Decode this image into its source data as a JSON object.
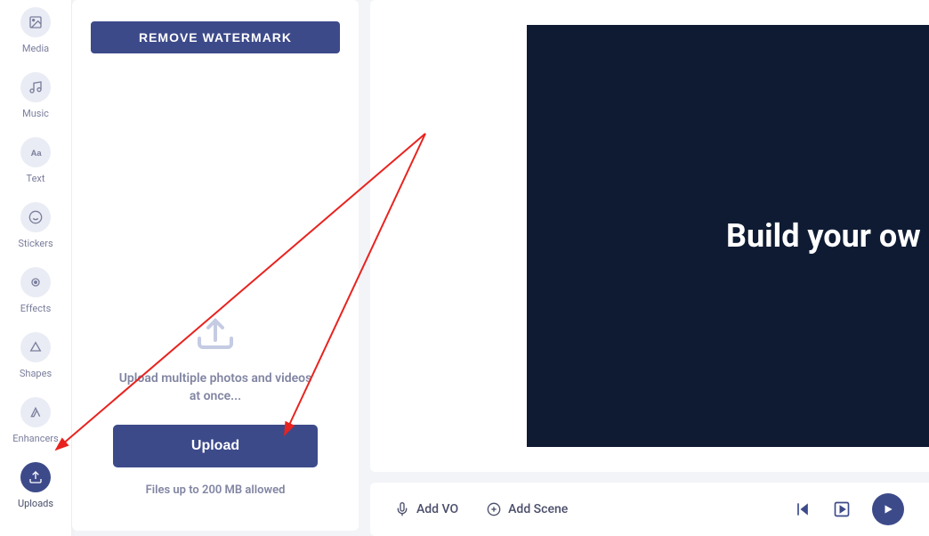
{
  "sidebar": {
    "items": [
      {
        "label": "Media",
        "icon": "image-icon"
      },
      {
        "label": "Music",
        "icon": "music-icon"
      },
      {
        "label": "Text",
        "icon": "text-icon"
      },
      {
        "label": "Stickers",
        "icon": "smiley-icon"
      },
      {
        "label": "Effects",
        "icon": "effects-icon"
      },
      {
        "label": "Shapes",
        "icon": "shapes-icon"
      },
      {
        "label": "Enhancers",
        "icon": "enhancers-icon"
      }
    ],
    "uploads_label": "Uploads"
  },
  "panel": {
    "remove_watermark": "REMOVE WATERMARK",
    "upload_prompt": "Upload multiple photos and videos at once...",
    "upload_button": "Upload",
    "file_limit": "Files up to 200 MB allowed"
  },
  "preview": {
    "text": "Build your ow"
  },
  "bottombar": {
    "add_vo": "Add VO",
    "add_scene": "Add Scene"
  }
}
